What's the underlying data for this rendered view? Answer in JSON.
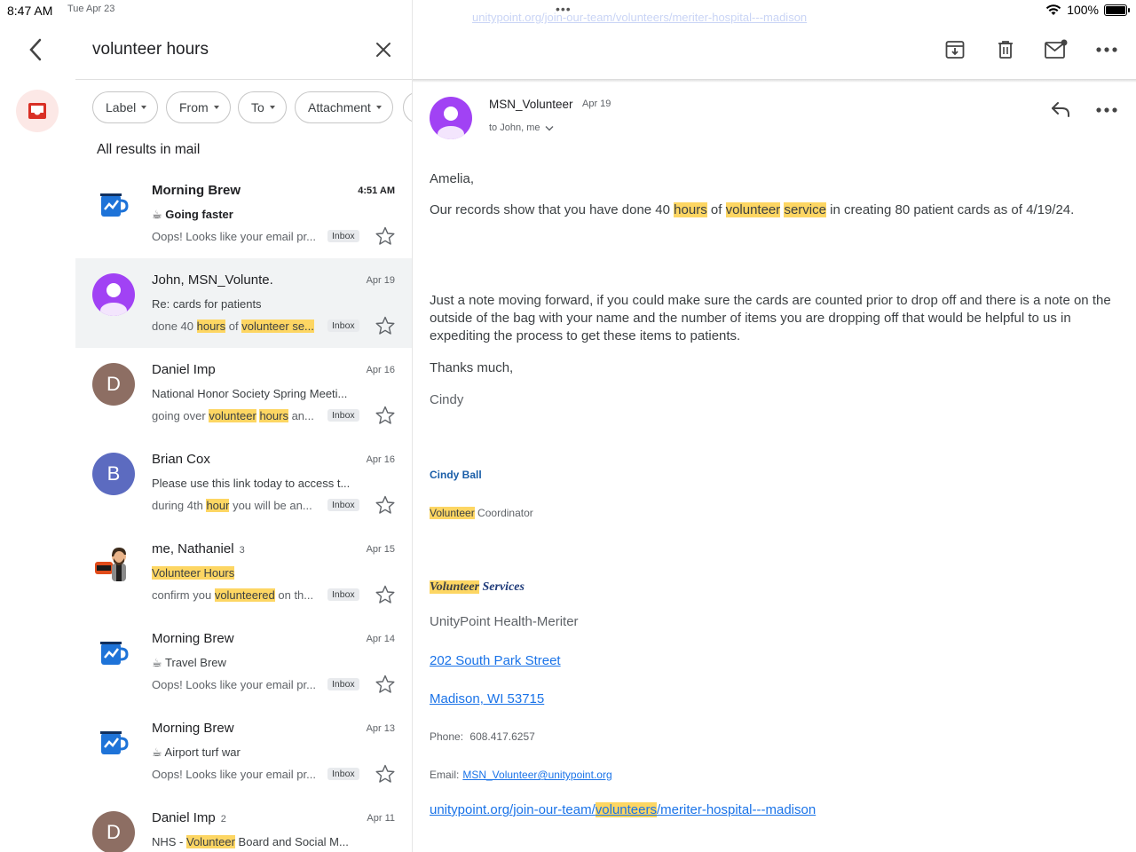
{
  "status": {
    "time": "8:47 AM",
    "date": "Tue Apr 23",
    "battery": "100%"
  },
  "search": {
    "query": "volunteer hours"
  },
  "chips": [
    "Label",
    "From",
    "To",
    "Attachment"
  ],
  "results_title": "All results in mail",
  "emails": [
    {
      "sender": "Morning Brew",
      "count": "",
      "date": "4:51 AM",
      "subject": "☕ Going faster",
      "snippet_pre": "Oops! Looks like your email pr...",
      "hl1": "",
      "mid": "",
      "hl2": "",
      "post": "",
      "badge": "Inbox",
      "unread": true,
      "avatar": "brew"
    },
    {
      "sender": "John, MSN_Volunte.",
      "count": "",
      "date": "Apr 19",
      "subject": "Re: cards for patients",
      "snippet_pre": "done 40 ",
      "hl1": "hours",
      "mid": " of ",
      "hl2": "volunteer",
      "post": " se...",
      "badge": "Inbox",
      "unread": false,
      "avatar": "person"
    },
    {
      "sender": "Daniel Imp",
      "count": "",
      "date": "Apr 16",
      "subject": "National Honor Society Spring Meeti...",
      "snippet_pre": "going over ",
      "hl1": "volunteer",
      "mid": " ",
      "hl2": "hours",
      "post": " an...",
      "badge": "Inbox",
      "unread": false,
      "avatar": "D"
    },
    {
      "sender": "Brian Cox",
      "count": "",
      "date": "Apr 16",
      "subject": "Please use this link today to access t...",
      "snippet_pre": "during 4th ",
      "hl1": "hour",
      "mid": " you will be an...",
      "hl2": "",
      "post": "",
      "badge": "Inbox",
      "unread": false,
      "avatar": "B"
    },
    {
      "sender": "me, Nathaniel",
      "count": "3",
      "date": "Apr 15",
      "subject_hl": "Volunteer Hours",
      "subject": "",
      "snippet_pre": "confirm you ",
      "hl1": "volunteered",
      "mid": " on th...",
      "hl2": "",
      "post": "",
      "badge": "Inbox",
      "unread": false,
      "avatar": "bitmoji"
    },
    {
      "sender": "Morning Brew",
      "count": "",
      "date": "Apr 14",
      "subject": "☕ Travel Brew",
      "snippet_pre": "Oops! Looks like your email pr...",
      "hl1": "",
      "mid": "",
      "hl2": "",
      "post": "",
      "badge": "Inbox",
      "unread": false,
      "avatar": "brew"
    },
    {
      "sender": "Morning Brew",
      "count": "",
      "date": "Apr 13",
      "subject": "☕ Airport turf war",
      "snippet_pre": "Oops! Looks like your email pr...",
      "hl1": "",
      "mid": "",
      "hl2": "",
      "post": "",
      "badge": "Inbox",
      "unread": false,
      "avatar": "brew"
    },
    {
      "sender": "Daniel Imp",
      "count": "2",
      "date": "Apr 11",
      "subject_pre": "NHS - ",
      "subject_hl": "Volunteer",
      "subject_post": " Board and Social M...",
      "subject": "",
      "snippet_pre": "",
      "hl1": "",
      "mid": "",
      "hl2": "",
      "post": "",
      "badge": "",
      "unread": false,
      "avatar": "D"
    }
  ],
  "message": {
    "faded_link": "unitypoint.org/join-our-team/volunteers/meriter-hospital---madison",
    "from": "MSN_Volunteer",
    "date": "Apr 19",
    "to": "to John, me",
    "greeting": "Amelia,",
    "p1_a": "Our records show that you have done 40 ",
    "p1_hl1": "hours",
    "p1_b": " of ",
    "p1_hl2": "volunteer",
    "p1_c": " ",
    "p1_hl3": "service",
    "p1_d": " in creating 80 patient cards as of 4/19/24.",
    "p2": "Just a note moving forward, if you could make sure the cards are counted prior to drop off and there is a note on the outside of the bag with your name and the number of items you are dropping off that would be helpful to us in expediting the process to get these items to patients.",
    "thanks": "Thanks much,",
    "signoff": "Cindy",
    "sig_name": "Cindy Ball",
    "sig_title_hl": "Volunteer",
    "sig_title_rest": " Coordinator",
    "sig_services_hl": "Volunteer",
    "sig_services_rest": " Services",
    "sig_org": "UnityPoint Health-Meriter",
    "address1": "202 South Park Street",
    "address2": "Madison, WI 53715",
    "phone_label": "Phone:",
    "phone": "608.417.6257",
    "email_label": "Email:",
    "email": "MSN_Volunteer@unitypoint.org",
    "url_pre": "unitypoint.org/join-our-team/",
    "url_hl": "volunteers",
    "url_post": "/meriter-hospital---madison"
  }
}
